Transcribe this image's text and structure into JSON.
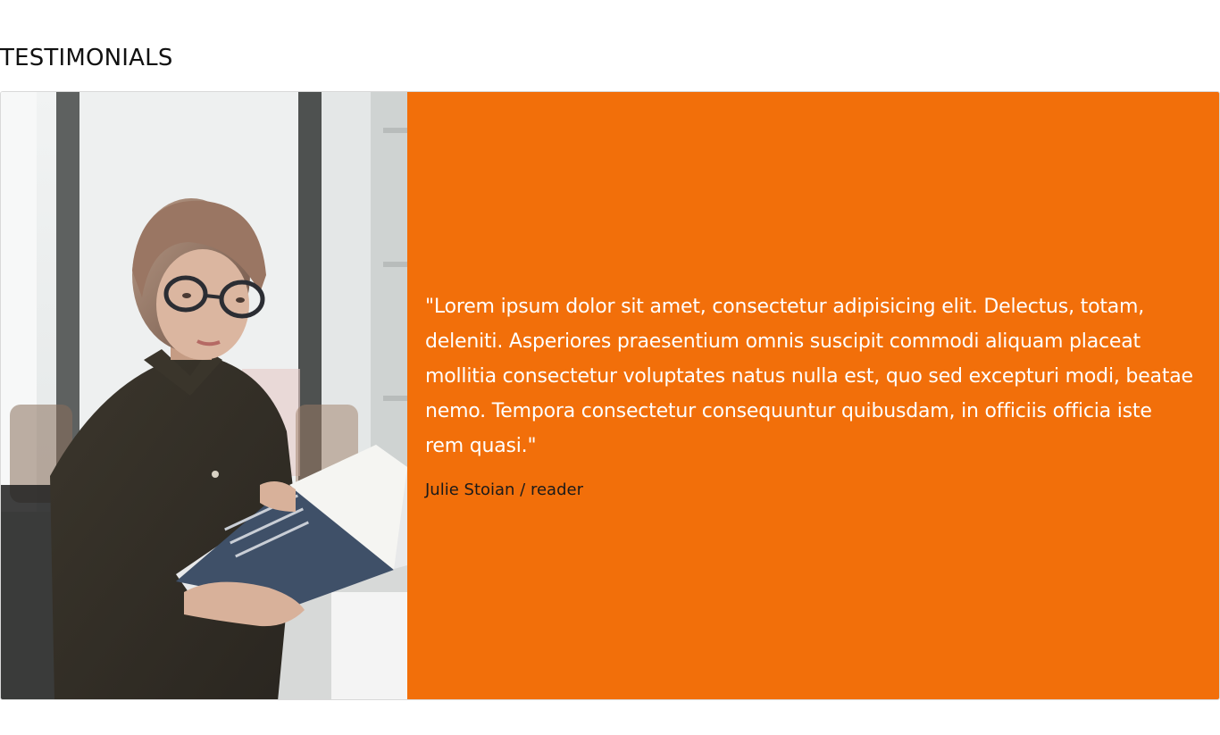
{
  "section": {
    "title": "TESTIMONIALS"
  },
  "testimonial": {
    "quote": "\"Lorem ipsum dolor sit amet, consectetur adipisicing elit. Delectus, totam, deleniti. Asperiores praesentium omnis suscipit commodi aliquam placeat mollitia consectetur voluptates natus nulla est, quo sed excepturi modi, beatae nemo. Tempora consectetur consequuntur quibusdam, in officiis officia iste rem quasi.\"",
    "author": "Julie Stoian / reader",
    "photo": "reader-portrait-photo"
  },
  "colors": {
    "accent": "#f26f0a",
    "quote_text": "#ffffff",
    "author_text": "#1a1a1a",
    "title_text": "#111111"
  }
}
